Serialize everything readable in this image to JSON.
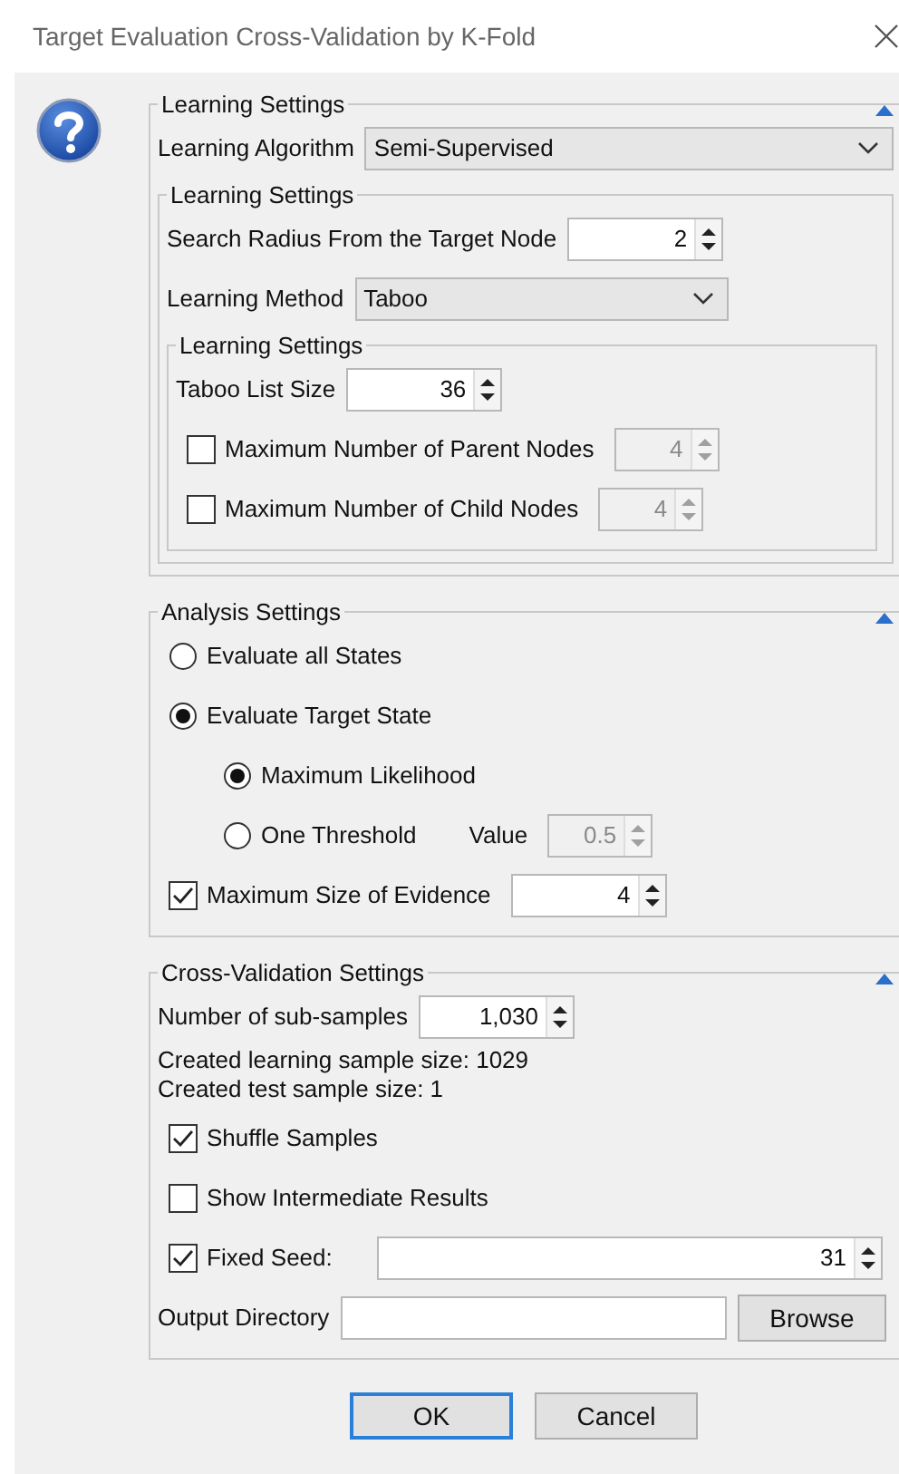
{
  "window": {
    "title": "Target Evaluation Cross-Validation by K-Fold"
  },
  "sections": [
    {
      "legend": "Learning Settings",
      "rows": [
        {
          "kind": "select",
          "label": "Learning Algorithm",
          "value": "Semi-Supervised"
        },
        {
          "kind": "group",
          "legend": "Learning Settings",
          "rows": [
            {
              "kind": "spinner",
              "label": "Search Radius From the Target Node",
              "value": "2",
              "disabled": false
            },
            {
              "kind": "select",
              "label": "Learning Method",
              "value": "Taboo"
            },
            {
              "kind": "group",
              "legend": "Learning Settings",
              "rows": [
                {
                  "kind": "spinner",
                  "label": "Taboo List Size",
                  "value": "36",
                  "disabled": false
                },
                {
                  "kind": "check",
                  "label": "Maximum Number of Parent Nodes",
                  "checked": false,
                  "value": "4",
                  "disabled": true
                },
                {
                  "kind": "check",
                  "label": "Maximum Number of Child Nodes",
                  "checked": false,
                  "value": "4",
                  "disabled": true
                }
              ]
            }
          ]
        }
      ]
    },
    {
      "legend": "Analysis Settings",
      "rows": [
        {
          "kind": "radio",
          "label": "Evaluate all States",
          "selected": false
        },
        {
          "kind": "radio",
          "label": "Evaluate Target State",
          "selected": true,
          "rows": [
            {
              "kind": "radio",
              "label": "Maximum Likelihood",
              "selected": true
            },
            {
              "kind": "radio",
              "label": "One Threshold",
              "selected": false,
              "value_label": "Value",
              "value": "0.5",
              "disabled": true
            }
          ]
        },
        {
          "kind": "check",
          "label": "Maximum Size of Evidence",
          "checked": true,
          "value": "4",
          "disabled": false
        }
      ]
    },
    {
      "legend": "Cross-Validation Settings",
      "rows": [
        {
          "kind": "spinner",
          "label": "Number of sub-samples",
          "value": "1,030",
          "disabled": false
        },
        {
          "kind": "text",
          "lines": [
            "Created learning sample size: 1029",
            "Created test sample size: 1"
          ]
        },
        {
          "kind": "check",
          "label": "Shuffle Samples",
          "checked": true
        },
        {
          "kind": "check",
          "label": "Show Intermediate Results",
          "checked": false
        },
        {
          "kind": "check",
          "label": "Fixed Seed:",
          "checked": true,
          "value": "31",
          "disabled": false,
          "wide": true
        },
        {
          "kind": "path",
          "label": "Output Directory",
          "button": "Browse"
        }
      ]
    }
  ],
  "buttons": [
    {
      "label": "OK",
      "default": true
    },
    {
      "label": "Cancel",
      "default": false
    }
  ]
}
